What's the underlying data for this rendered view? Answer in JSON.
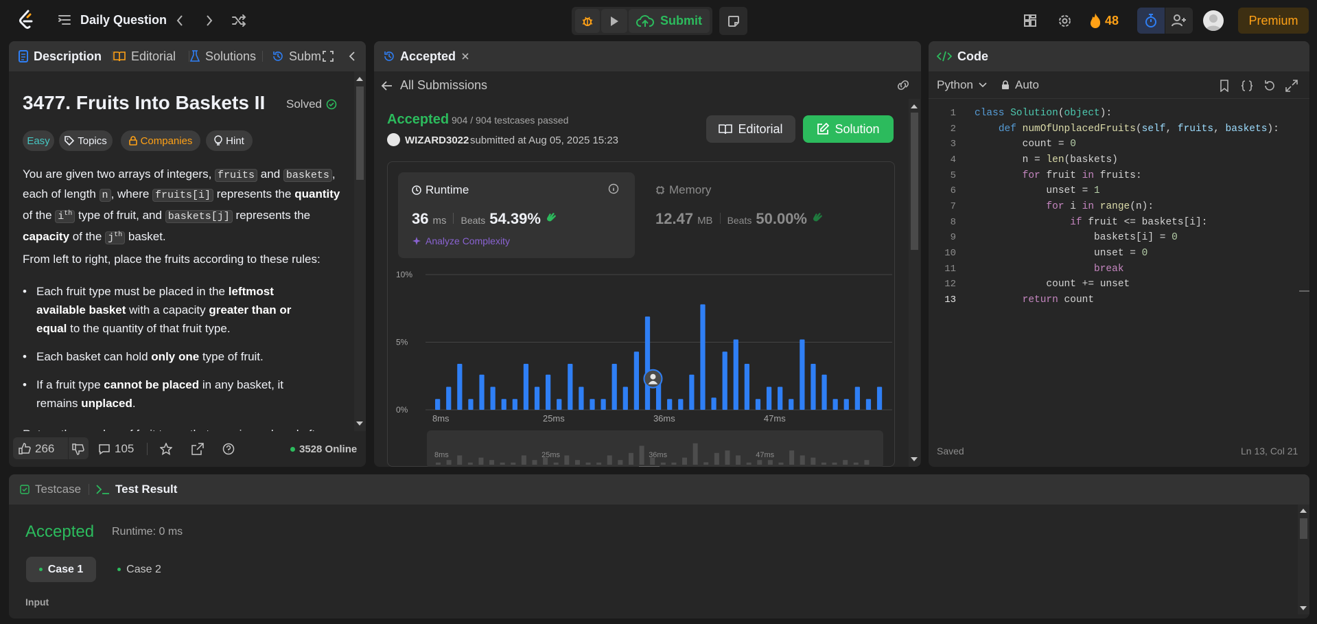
{
  "header": {
    "app_logo": "leetcode-logo-icon",
    "problem_list_label": "Daily Question",
    "submit_label": "Submit",
    "streak_count": "48",
    "premium_label": "Premium"
  },
  "left_panel": {
    "tabs": [
      {
        "label": "Description"
      },
      {
        "label": "Editorial"
      },
      {
        "label": "Solutions"
      },
      {
        "label": "Subm"
      }
    ],
    "problem_title": "3477. Fruits Into Baskets II",
    "solved_label": "Solved",
    "tags": {
      "difficulty": "Easy",
      "topics": "Topics",
      "companies": "Companies",
      "hint": "Hint"
    },
    "description": {
      "p1_a": "You are given two arrays of integers,",
      "code_fruits": "fruits",
      "p1_and": "and",
      "code_baskets": "baskets",
      "p1_b": "each of length",
      "code_n": "n",
      "p1_where": ", where",
      "code_fruits_i": "fruits[i]",
      "p1_represents": "represents the",
      "quantity": "quantity",
      "of_the": "of the",
      "i_base": "i",
      "th_sup": "th",
      "type_of_fruit": "type of fruit, and",
      "code_baskets_j": "baskets[j]",
      "represents_the": "represents the",
      "capacity": "capacity",
      "of_the_2": "of the",
      "j_base": "j",
      "th_sup2": "th",
      "basket_end": "basket.",
      "p2": "From left to right, place the fruits according to these rules:",
      "b1_a": "Each fruit type must be placed in the",
      "b1_leftmost": "leftmost available basket",
      "b1_b": "with a capacity",
      "b1_gte": "greater than or equal",
      "b1_c": "to the quantity of that fruit type.",
      "b2_a": "Each basket can hold",
      "b2_only": "only one",
      "b2_b": "type of fruit.",
      "b3_a": "If a fruit type",
      "b3_cannot": "cannot be placed",
      "b3_b": "in any basket, it remains",
      "b3_unplaced": "unplaced",
      "b3_end": ".",
      "p3": "Return the number of fruit types that remain unplaced after"
    },
    "footer": {
      "likes": "266",
      "comments": "105",
      "online": "3528 Online"
    }
  },
  "middle_panel": {
    "tab_label": "Accepted",
    "back_label": "All Submissions",
    "status": "Accepted",
    "testcases": "904 / 904 testcases passed",
    "username": "WIZARD3022",
    "submitted_at": "submitted at Aug 05, 2025 15:23",
    "editorial_button": "Editorial",
    "solution_button": "Solution",
    "runtime": {
      "label": "Runtime",
      "value": "36",
      "unit": "ms",
      "beats_label": "Beats",
      "beats": "54.39%",
      "analyze": "Analyze Complexity"
    },
    "memory": {
      "label": "Memory",
      "value": "12.47",
      "unit": "MB",
      "beats_label": "Beats",
      "beats": "50.00%"
    }
  },
  "chart_data": {
    "type": "bar",
    "title": "",
    "y_ticks": [
      "10%",
      "5%",
      "0%"
    ],
    "x_ticks": [
      "8ms",
      "25ms",
      "36ms",
      "47ms"
    ],
    "ylim": [
      0,
      10
    ],
    "values": [
      0.8,
      1.7,
      3.4,
      0.8,
      2.6,
      1.7,
      0.8,
      0.8,
      3.4,
      1.7,
      2.6,
      0.8,
      3.4,
      1.7,
      0.8,
      0.8,
      3.4,
      1.7,
      4.3,
      6.9,
      2.6,
      0.8,
      0.8,
      2.6,
      7.8,
      0.9,
      4.3,
      5.2,
      3.4,
      0.8,
      1.7,
      1.7,
      0.8,
      5.2,
      3.4,
      2.6,
      0.8,
      0.8,
      1.7,
      0.8,
      1.7
    ],
    "highlight_tick": "36ms",
    "minimap_ticks": [
      "8ms",
      "25ms",
      "36ms",
      "47ms"
    ],
    "bar_color": "#2f7ff5"
  },
  "right_panel": {
    "tab_label": "Code",
    "language": "Python",
    "auto_label": "Auto",
    "code_lines": [
      "class Solution(object):",
      "    def numOfUnplacedFruits(self, fruits, baskets):",
      "        count = 0",
      "        n = len(baskets)",
      "        for fruit in fruits:",
      "            unset = 1",
      "            for i in range(n):",
      "                if fruit <= baskets[i]:",
      "                    baskets[i] = 0",
      "                    unset = 0",
      "                    break",
      "            count += unset",
      "        return count"
    ],
    "line_numbers": [
      "1",
      "2",
      "3",
      "4",
      "5",
      "6",
      "7",
      "8",
      "9",
      "10",
      "11",
      "12",
      "13"
    ],
    "saved_label": "Saved",
    "cursor_pos": "Ln 13, Col 21"
  },
  "bottom_panel": {
    "testcase_tab": "Testcase",
    "result_tab": "Test Result",
    "status": "Accepted",
    "runtime": "Runtime: 0 ms",
    "case1": "Case 1",
    "case2": "Case 2",
    "input_label": "Input"
  },
  "colors": {
    "accent_green": "#2cbb5d",
    "accent_blue": "#2f7ff5",
    "streak_orange": "#ffa116",
    "premium_bg": "#3d2f12"
  }
}
